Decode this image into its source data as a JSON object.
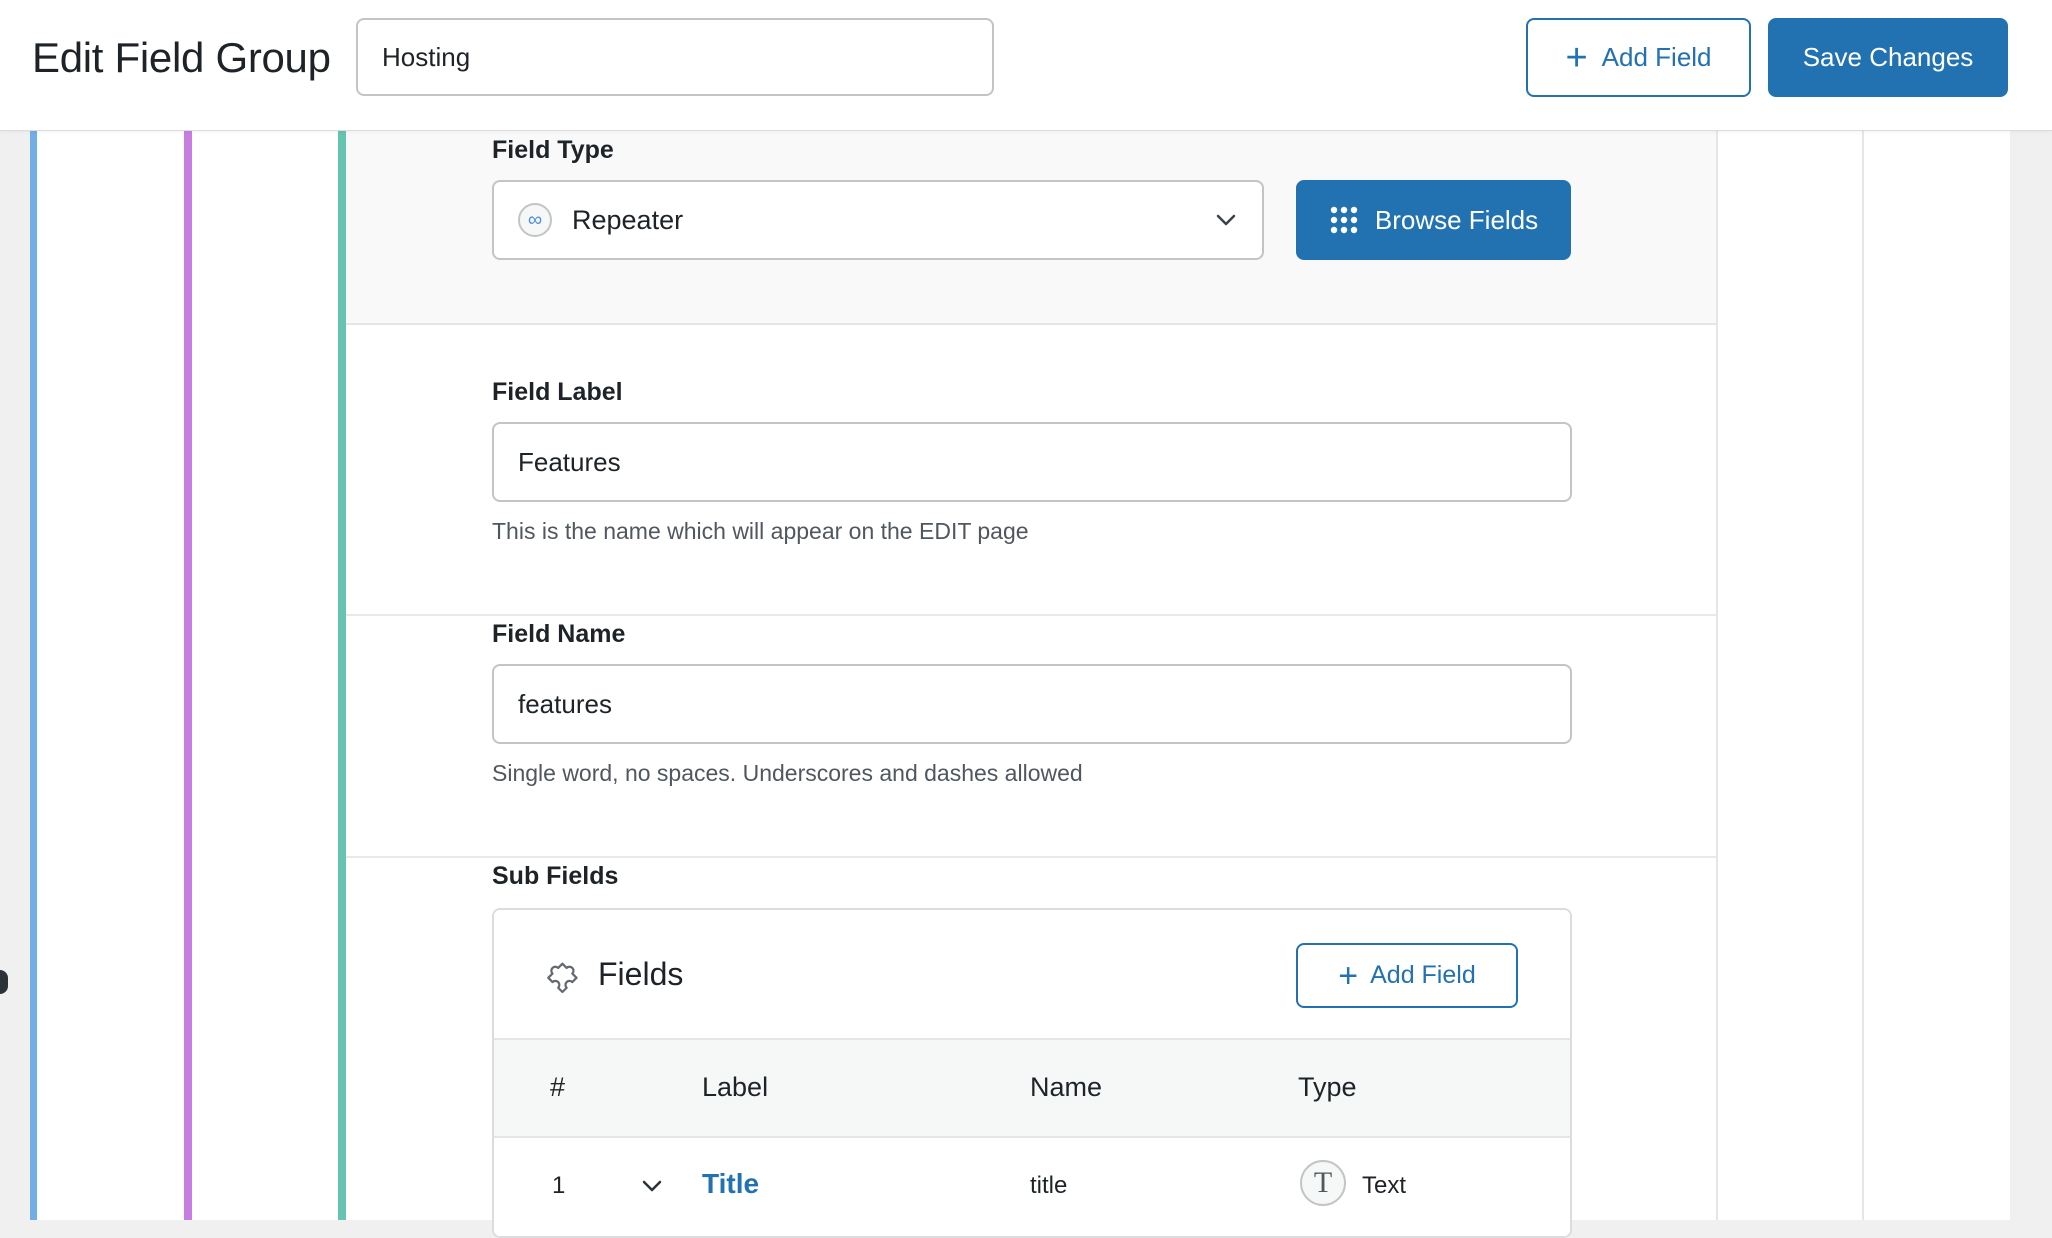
{
  "header": {
    "page_title": "Edit Field Group",
    "group_title_value": "Hosting",
    "add_field_label": "Add Field",
    "save_label": "Save Changes"
  },
  "field_type": {
    "label": "Field Type",
    "value": "Repeater",
    "value_icon": "infinity-icon",
    "browse_label": "Browse Fields"
  },
  "field_label": {
    "label": "Field Label",
    "value": "Features",
    "hint": "This is the name which will appear on the EDIT page"
  },
  "field_name": {
    "label": "Field Name",
    "value": "features",
    "hint": "Single word, no spaces. Underscores and dashes allowed"
  },
  "sub_fields": {
    "label": "Sub Fields",
    "box_title": "Fields",
    "add_label": "Add Field",
    "columns": [
      "#",
      "Label",
      "Name",
      "Type"
    ],
    "rows": [
      {
        "order": "1",
        "label": "Title",
        "name": "title",
        "type": "Text",
        "type_glyph": "T"
      }
    ]
  },
  "colors": {
    "accent": "#2271b1",
    "stripe_blue": "#72aee6",
    "stripe_purple": "#c77ee0",
    "stripe_teal": "#68c4b2"
  }
}
